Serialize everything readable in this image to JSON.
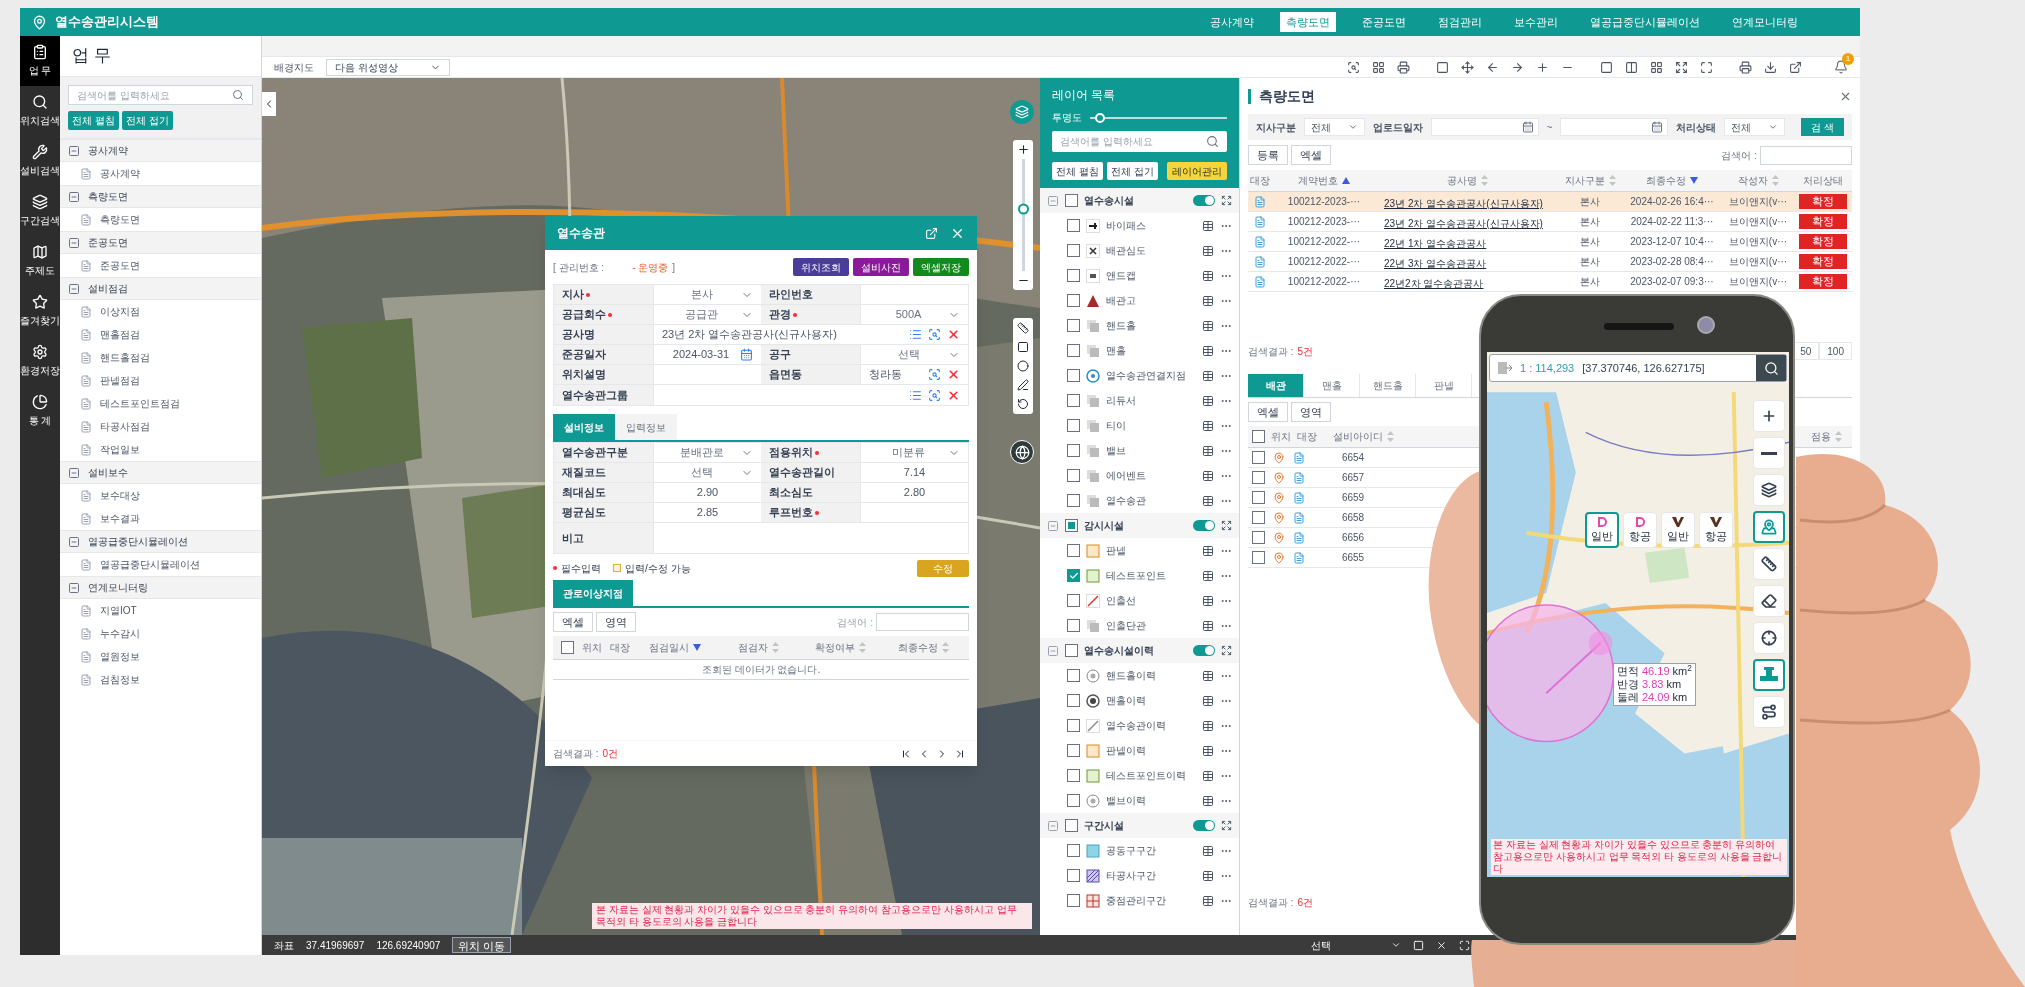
{
  "app": {
    "title": "열수송관리시스템",
    "notifications": "1",
    "menu": [
      {
        "label": "공사계약",
        "selected": false
      },
      {
        "label": "측량도면",
        "selected": true
      },
      {
        "label": "준공도면",
        "selected": false
      },
      {
        "label": "점검관리",
        "selected": false
      },
      {
        "label": "보수관리",
        "selected": false
      },
      {
        "label": "열공급중단시뮬레이션",
        "selected": false
      },
      {
        "label": "연계모니터링",
        "selected": false
      }
    ]
  },
  "rail": [
    {
      "label": "업 무",
      "selected": true
    },
    {
      "label": "위치검색",
      "selected": false
    },
    {
      "label": "설비검색",
      "selected": false
    },
    {
      "label": "구간검색",
      "selected": false
    },
    {
      "label": "주제도",
      "selected": false
    },
    {
      "label": "즐겨찾기",
      "selected": false
    },
    {
      "label": "환경저장",
      "selected": false
    },
    {
      "label": "통 계",
      "selected": false
    }
  ],
  "task_panel": {
    "title": "업 무",
    "search_placeholder": "검색어를 입력하세요",
    "buttons": [
      "전체 펼침",
      "전체 접기"
    ],
    "groups": [
      {
        "label": "공사계약",
        "expanded": true,
        "children": [
          {
            "label": "공사계약"
          }
        ]
      },
      {
        "label": "측량도면",
        "expanded": true,
        "children": [
          {
            "label": "측량도면"
          }
        ]
      },
      {
        "label": "준공도면",
        "expanded": true,
        "children": [
          {
            "label": "준공도면"
          }
        ]
      },
      {
        "label": "설비점검",
        "expanded": true,
        "children": [
          {
            "label": "이상지점"
          },
          {
            "label": "맨홀점검"
          },
          {
            "label": "핸드홀점검"
          },
          {
            "label": "판넬점검"
          },
          {
            "label": "테스트포인트점검"
          },
          {
            "label": "타공사점검"
          },
          {
            "label": "작업일보"
          }
        ]
      },
      {
        "label": "설비보수",
        "expanded": true,
        "children": [
          {
            "label": "보수대상"
          },
          {
            "label": "보수결과"
          }
        ]
      },
      {
        "label": "열공급중단시뮬레이션",
        "expanded": true,
        "children": [
          {
            "label": "열공급중단시뮬레이션"
          }
        ]
      },
      {
        "label": "연계모니터링",
        "expanded": true,
        "children": [
          {
            "label": "지열IOT"
          },
          {
            "label": "누수감시"
          },
          {
            "label": "열원정보"
          },
          {
            "label": "검침정보"
          }
        ]
      }
    ]
  },
  "map_toolbar": {
    "label": "배경지도",
    "basemap": "다음 위성영상"
  },
  "map": {
    "zoom_slider": {
      "level": 0.55
    },
    "disclaimer": "본 자료는 실제 현황과 차이가 있을수 있으므로 충분히 유의하여 참고용으로만 사용하시고 업무 목적외 타 용도로의 사용을 금합니다",
    "status": {
      "label": "좌표",
      "lat": "37.41969697",
      "lon": "126.69240907",
      "button": "위치 이동",
      "select": "선택"
    }
  },
  "dialog": {
    "title": "열수송관",
    "id_label": "[ 관리번호 :",
    "status": "- 운영중",
    "id_end": "]",
    "buttons": [
      {
        "label": "위치조회",
        "color": "#4a3d9a"
      },
      {
        "label": "설비사진",
        "color": "#8b1a9a"
      },
      {
        "label": "엑셀저장",
        "color": "#138a1c"
      }
    ],
    "form": [
      {
        "cells": [
          {
            "label": "지사",
            "required": true,
            "kind": "select",
            "value": "본사"
          },
          {
            "label": "라인번호",
            "required": false,
            "kind": "text"
          }
        ]
      },
      {
        "cells": [
          {
            "label": "공급회수",
            "required": true,
            "kind": "select",
            "value": "공급관"
          },
          {
            "label": "관경",
            "required": true,
            "kind": "select",
            "value": "500A"
          }
        ]
      },
      {
        "cells": [
          {
            "label": "공사명",
            "required": false,
            "kind": "lookup",
            "list_button": true,
            "value": "23년 2차 열수송관공사(신규사용자)"
          }
        ]
      },
      {
        "cells": [
          {
            "label": "준공일자",
            "required": false,
            "kind": "date",
            "value": "2024-03-31"
          },
          {
            "label": "공구",
            "required": false,
            "kind": "select",
            "value": "선택"
          }
        ]
      },
      {
        "cells": [
          {
            "label": "위치설명",
            "required": false,
            "kind": "text"
          },
          {
            "label": "읍면동",
            "required": false,
            "kind": "lookup",
            "list_button": false,
            "value": "청라동"
          }
        ]
      },
      {
        "cells": [
          {
            "label": "열수송관그룹",
            "required": false,
            "kind": "lookup",
            "list_button": true
          }
        ]
      }
    ],
    "tabs": [
      {
        "label": "설비정보",
        "selected": true
      },
      {
        "label": "입력정보",
        "selected": false
      }
    ],
    "form2": [
      {
        "cells": [
          {
            "label": "열수송관구분",
            "required": false,
            "kind": "select",
            "value": "분배관로"
          },
          {
            "label": "점용위치",
            "required": true,
            "kind": "select",
            "value": "미분류"
          }
        ]
      },
      {
        "cells": [
          {
            "label": "재질코드",
            "required": false,
            "kind": "select",
            "value": "선택"
          },
          {
            "label": "열수송관길이",
            "required": false,
            "kind": "text",
            "value": "7.14"
          }
        ]
      },
      {
        "cells": [
          {
            "label": "최대심도",
            "required": false,
            "kind": "text",
            "value": "2.90"
          },
          {
            "label": "최소심도",
            "required": false,
            "kind": "text",
            "value": "2.80"
          }
        ]
      },
      {
        "cells": [
          {
            "label": "평균심도",
            "required": false,
            "kind": "text",
            "value": "2.85"
          },
          {
            "label": "루프번호",
            "required": true,
            "kind": "text"
          }
        ]
      },
      {
        "cells": [
          {
            "label": "비고",
            "required": false,
            "kind": "memo"
          }
        ]
      }
    ],
    "legend": {
      "required": "필수입력",
      "editable": "입력/수정 가능"
    },
    "edit_button": "수정",
    "sub": {
      "tab": "관로이상지점",
      "buttons": [
        "엑셀",
        "영역"
      ],
      "search_label": "검색어 :",
      "select_all_checked": false,
      "columns": [
        {
          "label": "위치",
          "kind": "plain"
        },
        {
          "label": "대장",
          "kind": "plain"
        },
        {
          "label": "점검일시",
          "kind": "descending"
        },
        {
          "label": "점검자",
          "kind": "sortable"
        },
        {
          "label": "확정여부",
          "kind": "sortable"
        },
        {
          "label": "최종수정",
          "kind": "sortable"
        }
      ],
      "empty": "조회된 데이터가 없습니다.",
      "result_label": "검색결과 :",
      "result_count": "0건"
    }
  },
  "layers": {
    "title": "레이어 목록",
    "opacity_label": "투명도",
    "opacity": {
      "level": 0.04
    },
    "search_placeholder": "검색어를 입력하세요",
    "buttons": [
      "전체 펼침",
      "전체 접기"
    ],
    "manage_button": "레이어관리",
    "groups": [
      {
        "label": "열수송시설",
        "checked": false,
        "partial": false,
        "on": true,
        "expanded": true,
        "children": [
          {
            "label": "바이패스",
            "checked": false
          },
          {
            "label": "배관심도",
            "checked": false
          },
          {
            "label": "앤드캡",
            "checked": false
          },
          {
            "label": "배관고",
            "checked": false
          },
          {
            "label": "핸드홀",
            "checked": false
          },
          {
            "label": "맨홀",
            "checked": false
          },
          {
            "label": "열수송관연결지점",
            "checked": false
          },
          {
            "label": "리듀서",
            "checked": false
          },
          {
            "label": "티이",
            "checked": false
          },
          {
            "label": "밸브",
            "checked": false
          },
          {
            "label": "에어벤트",
            "checked": false
          },
          {
            "label": "열수송관",
            "checked": false
          }
        ]
      },
      {
        "label": "감시시설",
        "checked": false,
        "partial": true,
        "on": true,
        "expanded": true,
        "children": [
          {
            "label": "판넬",
            "checked": false
          },
          {
            "label": "테스트포인트",
            "checked": true
          },
          {
            "label": "인출선",
            "checked": false
          },
          {
            "label": "인출단관",
            "checked": false
          }
        ]
      },
      {
        "label": "열수송시설이력",
        "checked": false,
        "partial": false,
        "on": true,
        "expanded": true,
        "children": [
          {
            "label": "핸드홀이력",
            "checked": false
          },
          {
            "label": "맨홀이력",
            "checked": false
          },
          {
            "label": "열수송관이력",
            "checked": false
          },
          {
            "label": "판넬이력",
            "checked": false
          },
          {
            "label": "테스트포인트이력",
            "checked": false
          },
          {
            "label": "밸브이력",
            "checked": false
          }
        ]
      },
      {
        "label": "구간시설",
        "checked": false,
        "partial": false,
        "on": true,
        "expanded": true,
        "children": [
          {
            "label": "공동구구간",
            "checked": false
          },
          {
            "label": "타공사구간",
            "checked": false
          },
          {
            "label": "중점관리구간",
            "checked": false
          }
        ]
      }
    ]
  },
  "survey": {
    "title": "측량도면",
    "filters": [
      {
        "label": "지사구분",
        "kind": "select",
        "value": "전체"
      },
      {
        "label": "업로드일자",
        "kind": "daterange",
        "separator": "~"
      },
      {
        "label": "처리상태",
        "kind": "select",
        "value": "전체"
      }
    ],
    "search_button": "검 색",
    "buttons": [
      "등록",
      "엑셀"
    ],
    "search_label": "검색어 :",
    "columns": [
      {
        "label": "대장",
        "kind": "plain"
      },
      {
        "label": "계약번호",
        "kind": "ascending"
      },
      {
        "label": "공사명",
        "kind": "sortable"
      },
      {
        "label": "지사구분",
        "kind": "sortable"
      },
      {
        "label": "최종수정",
        "kind": "descending"
      },
      {
        "label": "작성자",
        "kind": "sortable"
      },
      {
        "label": "처리상태",
        "kind": "plain"
      }
    ],
    "rows": [
      {
        "selected": true,
        "contract": "100212-2023-···",
        "name": "23년 2차 열수송관공사(신규사용자)",
        "branch": "본사",
        "modified": "2024-02-26 16:4···",
        "author": "브이앤지(v···",
        "status": "확정"
      },
      {
        "selected": false,
        "contract": "100212-2023-···",
        "name": "23년 2차 열수송관공사(신규사용자)",
        "branch": "본사",
        "modified": "2024-02-22 11:3···",
        "author": "브이앤지(v···",
        "status": "확정"
      },
      {
        "selected": false,
        "contract": "100212-2022-···",
        "name": "22년 1차 열수송관공사",
        "branch": "본사",
        "modified": "2023-12-07 10:4···",
        "author": "브이앤지(v···",
        "status": "확정"
      },
      {
        "selected": false,
        "contract": "100212-2022-···",
        "name": "22년 3차 열수송관공사",
        "branch": "본사",
        "modified": "2023-02-28 08:4···",
        "author": "브이앤지(v···",
        "status": "확정"
      },
      {
        "selected": false,
        "contract": "100212-2022-···",
        "name": "22년2차 열수송관공사",
        "branch": "본사",
        "modified": "2023-02-07 09:3···",
        "author": "브이앤지(v···",
        "status": "확정"
      }
    ],
    "result_label": "검색결과 :",
    "result_count": "5건",
    "page_sizes": [
      {
        "label": "50",
        "selected": false
      },
      {
        "label": "100",
        "selected": false
      }
    ],
    "facility_tabs": [
      {
        "label": "배관",
        "selected": true
      },
      {
        "label": "맨홀",
        "selected": false
      },
      {
        "label": "핸드홀",
        "selected": false
      },
      {
        "label": "판넬",
        "selected": false
      }
    ],
    "facility_buttons": [
      "엑셀",
      "영역"
    ],
    "facility_select_all": false,
    "facility_columns": [
      {
        "label": "위치",
        "kind": "plain"
      },
      {
        "label": "대장",
        "kind": "plain"
      },
      {
        "label": "설비아이디",
        "kind": "sortable"
      },
      {
        "label": "점용",
        "kind": "sortable"
      }
    ],
    "facility_rows": [
      {
        "id": "6654",
        "checked": false
      },
      {
        "id": "6657",
        "checked": false
      },
      {
        "id": "6659",
        "checked": false
      },
      {
        "id": "6658",
        "checked": false
      },
      {
        "id": "6656",
        "checked": false
      },
      {
        "id": "6655",
        "checked": false
      }
    ],
    "facility_result_label": "검색결과 :",
    "facility_result_count": "6건"
  },
  "phone": {
    "scale": "1 : 114,293",
    "coords": "[37.370746, 126.627175]",
    "map_types": [
      {
        "label": "일반",
        "selected": true
      },
      {
        "label": "항공",
        "selected": false
      },
      {
        "label": "일반",
        "selected": false
      },
      {
        "label": "항공",
        "selected": false
      }
    ],
    "tools": [
      {
        "selected": false
      },
      {
        "selected": false
      },
      {
        "selected": false
      },
      {
        "selected": true
      },
      {
        "selected": false
      },
      {
        "selected": false
      },
      {
        "selected": false
      },
      {
        "selected": true
      },
      {
        "selected": false
      }
    ],
    "measure": [
      {
        "label": "면적",
        "value": "46.19",
        "unit": "km$^{2}$"
      },
      {
        "label": "반경",
        "value": "3.83",
        "unit": "km"
      },
      {
        "label": "둘레",
        "value": "24.09",
        "unit": "km"
      }
    ],
    "disclaimer": "본 자료는 실제 현황과 차이가 있을수 있으므로 충분히 유의하여 참고용으로만 사용하시고 업무 목적외 타 용도로의 사용을 금합니다"
  }
}
